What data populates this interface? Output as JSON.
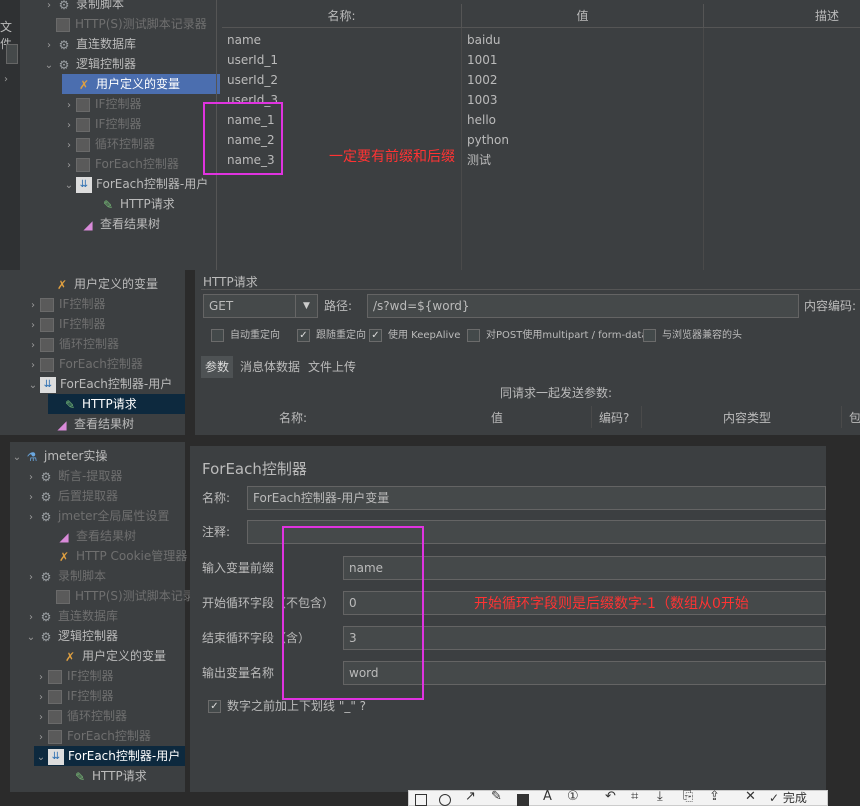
{
  "top_tree": [
    {
      "label": "录制脚本",
      "type": "gear",
      "arrow": "›",
      "dis": false
    },
    {
      "label": "HTTP(S)测试脚本记录器",
      "type": "box",
      "arrow": "",
      "dis": true
    },
    {
      "label": "直连数据库",
      "type": "gear",
      "arrow": "›",
      "dis": false
    },
    {
      "label": "逻辑控制器",
      "type": "gear",
      "arrow": "⌄",
      "dis": false
    },
    {
      "label": "用户定义的变量",
      "type": "tool",
      "arrow": "",
      "dis": false
    },
    {
      "label": "IF控制器",
      "type": "box",
      "arrow": "›",
      "dis": true
    },
    {
      "label": "IF控制器",
      "type": "box",
      "arrow": "›",
      "dis": true
    },
    {
      "label": "循环控制器",
      "type": "box",
      "arrow": "›",
      "dis": true
    },
    {
      "label": "ForEach控制器",
      "type": "box",
      "arrow": "›",
      "dis": true
    },
    {
      "label": "ForEach控制器-用户",
      "type": "fe",
      "arrow": "⌄",
      "dis": false
    },
    {
      "label": "HTTP请求",
      "type": "pen",
      "arrow": "",
      "dis": false
    },
    {
      "label": "查看结果树",
      "type": "chart",
      "arrow": "",
      "dis": false
    }
  ],
  "left_edge": {
    "label": "文件"
  },
  "var_table": {
    "headers": [
      "名称:",
      "值",
      "描述"
    ],
    "rows": [
      {
        "name": "name",
        "value": "baidu"
      },
      {
        "name": "userId_1",
        "value": "1001"
      },
      {
        "name": "userId_2",
        "value": "1002"
      },
      {
        "name": "userId_3",
        "value": "1003"
      },
      {
        "name": "name_1",
        "value": "hello"
      },
      {
        "name": "name_2",
        "value": "python"
      },
      {
        "name": "name_3",
        "value": "测试"
      }
    ]
  },
  "annotation_top": "一定要有前缀和后缀",
  "mid_tree": [
    {
      "label": "用户定义的变量",
      "type": "tool",
      "arrow": "",
      "dis": false
    },
    {
      "label": "IF控制器",
      "type": "box",
      "arrow": "›",
      "dis": true
    },
    {
      "label": "IF控制器",
      "type": "box",
      "arrow": "›",
      "dis": true
    },
    {
      "label": "循环控制器",
      "type": "box",
      "arrow": "›",
      "dis": true
    },
    {
      "label": "ForEach控制器",
      "type": "box",
      "arrow": "›",
      "dis": true
    },
    {
      "label": "ForEach控制器-用户",
      "type": "fe",
      "arrow": "⌄",
      "dis": false
    },
    {
      "label": "HTTP请求",
      "type": "pen",
      "arrow": "",
      "dis": false
    },
    {
      "label": "查看结果树",
      "type": "chart",
      "arrow": "",
      "dis": false
    }
  ],
  "http": {
    "section": "HTTP请求",
    "method": "GET",
    "path_label": "路径:",
    "path_value": "/s?wd=${word}",
    "encoding_label": "内容编码:",
    "checks": [
      "自动重定向",
      "跟随重定向",
      "使用 KeepAlive",
      "对POST使用multipart / form-data",
      "与浏览器兼容的头"
    ],
    "tabs": [
      "参数",
      "消息体数据",
      "文件上传"
    ],
    "params_caption": "同请求一起发送参数:",
    "param_headers": [
      "名称:",
      "值",
      "编码?",
      "内容类型",
      "包"
    ]
  },
  "bottom_tree": [
    {
      "label": "jmeter实操",
      "type": "flask",
      "arrow": "⌄",
      "dis": false
    },
    {
      "label": "断言-提取器",
      "type": "gear",
      "arrow": "›",
      "dis": true
    },
    {
      "label": "后置提取器",
      "type": "gear",
      "arrow": "›",
      "dis": true
    },
    {
      "label": "jmeter全局属性设置",
      "type": "gear",
      "arrow": "›",
      "dis": true
    },
    {
      "label": "查看结果树",
      "type": "chart",
      "arrow": "",
      "dis": true
    },
    {
      "label": "HTTP Cookie管理器",
      "type": "tool",
      "arrow": "",
      "dis": true
    },
    {
      "label": "录制脚本",
      "type": "gear",
      "arrow": "›",
      "dis": true
    },
    {
      "label": "HTTP(S)测试脚本记录器",
      "type": "box",
      "arrow": "",
      "dis": true
    },
    {
      "label": "直连数据库",
      "type": "gear",
      "arrow": "›",
      "dis": true
    },
    {
      "label": "逻辑控制器",
      "type": "gear",
      "arrow": "⌄",
      "dis": false
    },
    {
      "label": "用户定义的变量",
      "type": "tool",
      "arrow": "",
      "dis": false
    },
    {
      "label": "IF控制器",
      "type": "box",
      "arrow": "›",
      "dis": true
    },
    {
      "label": "IF控制器",
      "type": "box",
      "arrow": "›",
      "dis": true
    },
    {
      "label": "循环控制器",
      "type": "box",
      "arrow": "›",
      "dis": true
    },
    {
      "label": "ForEach控制器",
      "type": "box",
      "arrow": "›",
      "dis": true
    },
    {
      "label": "ForEach控制器-用户",
      "type": "fe",
      "arrow": "⌄",
      "dis": false
    },
    {
      "label": "HTTP请求",
      "type": "pen",
      "arrow": "",
      "dis": false
    }
  ],
  "foreach": {
    "title": "ForEach控制器",
    "name_label": "名称:",
    "name_value": "ForEach控制器-用户变量",
    "comment_label": "注释:",
    "prefix_label": "输入变量前缀",
    "prefix_value": "name",
    "start_label": "开始循环字段（不包含）",
    "start_value": "0",
    "end_label": "结束循环字段（含）",
    "end_value": "3",
    "output_label": "输出变量名称",
    "output_value": "word",
    "underscore_label": "数字之前加上下划线 \"_\" ?"
  },
  "annotation_bottom": "开始循环字段则是后缀数字-1（数组从0开始",
  "toolbar": {
    "done_label": "完成"
  },
  "colors": {
    "accent": "#e033e0",
    "annotation": "#ff3333",
    "selection": "#4b6eaf",
    "bg": "#2b2b2b"
  }
}
